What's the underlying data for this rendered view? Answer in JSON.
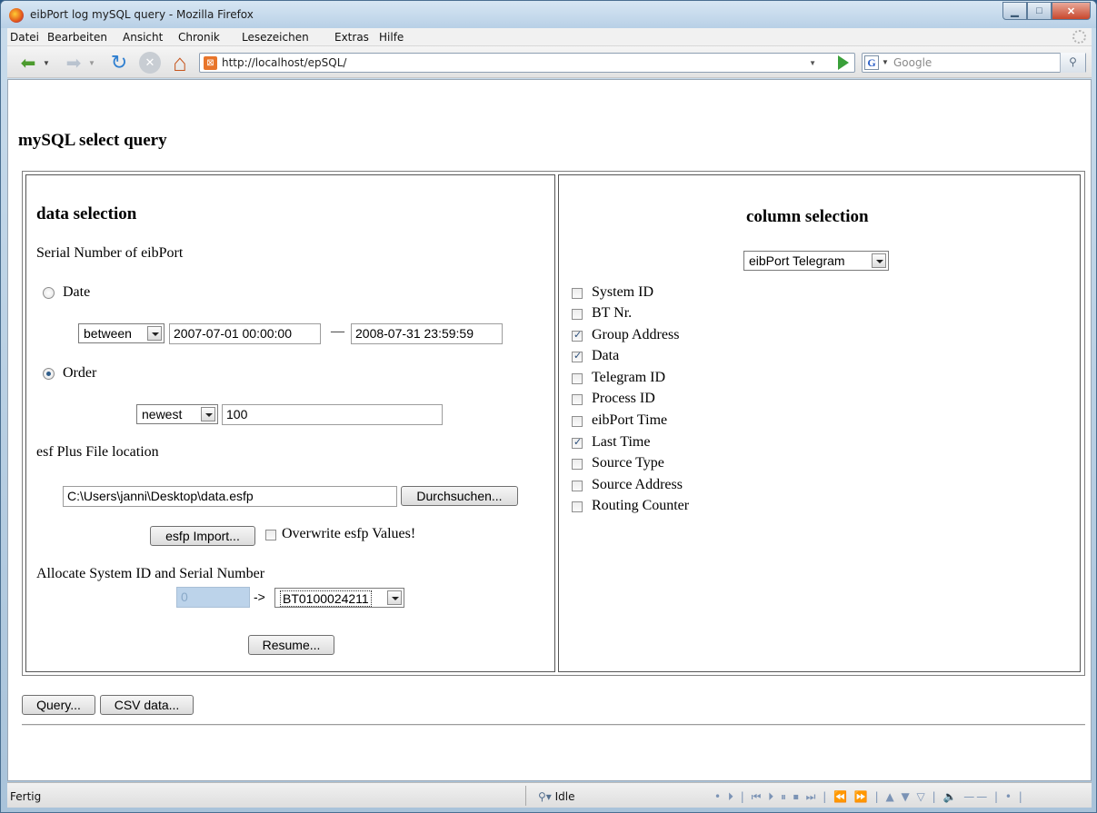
{
  "window": {
    "title": "eibPort log mySQL query - Mozilla Firefox",
    "minimize_glyph": "▁",
    "maximize_glyph": "□",
    "close_glyph": "✕"
  },
  "menu": [
    "Datei",
    "Bearbeiten",
    "Ansicht",
    "Chronik",
    "Lesezeichen",
    "Extras",
    "Hilfe"
  ],
  "nav": {
    "url": "http://localhost/epSQL/",
    "search_engine": "G",
    "search_placeholder": "Google",
    "back_glyph": "⬅",
    "forward_glyph": "➡",
    "reload_glyph": "↻",
    "stop_glyph": "✕",
    "home_glyph": "⌂",
    "search_glyph": "⚲",
    "dropdown_glyph": "▼"
  },
  "page": {
    "title": "mySQL select query"
  },
  "data_selection": {
    "heading": "data selection",
    "serial_label": "Serial Number of eibPort",
    "date_label": "Date",
    "date_checked": false,
    "date_mode": "between",
    "date_from": "2007-07-01 00:00:00",
    "date_separator": "—",
    "date_to": "2008-07-31 23:59:59",
    "order_label": "Order",
    "order_checked": true,
    "order_mode": "newest",
    "order_count": "100",
    "esf_label": "esf Plus File location",
    "esf_path": "C:\\Users\\janni\\Desktop\\data.esfp",
    "browse_button": "Durchsuchen...",
    "import_button": "esfp Import...",
    "overwrite_label": "Overwrite esfp Values!",
    "overwrite_checked": false,
    "allocate_label": "Allocate System ID and Serial Number",
    "system_id": "0",
    "arrow_text": "->",
    "serial_selected": "BT0100024211",
    "resume_button": "Resume..."
  },
  "column_selection": {
    "heading": "column selection",
    "table_selected": "eibPort Telegram",
    "columns": [
      {
        "label": "System ID",
        "checked": false
      },
      {
        "label": "BT Nr.",
        "checked": false
      },
      {
        "label": "Group Address",
        "checked": true
      },
      {
        "label": "Data",
        "checked": true
      },
      {
        "label": "Telegram ID",
        "checked": false
      },
      {
        "label": "Process ID",
        "checked": false
      },
      {
        "label": "eibPort Time",
        "checked": false
      },
      {
        "label": "Last Time",
        "checked": true
      },
      {
        "label": "Source Type",
        "checked": false
      },
      {
        "label": "Source Address",
        "checked": false
      },
      {
        "label": "Routing Counter",
        "checked": false
      }
    ]
  },
  "actions": {
    "query_button": "Query...",
    "csv_button": "CSV data..."
  },
  "status": {
    "text": "Fertig",
    "idle": "Idle",
    "media_controls": "• ⏵ | ⏮ ⏵ ⏸ ⏹ ⏭ | ⏪ ⏩ | ▲ ▼ ▽ | 🔈 —— | • |"
  }
}
